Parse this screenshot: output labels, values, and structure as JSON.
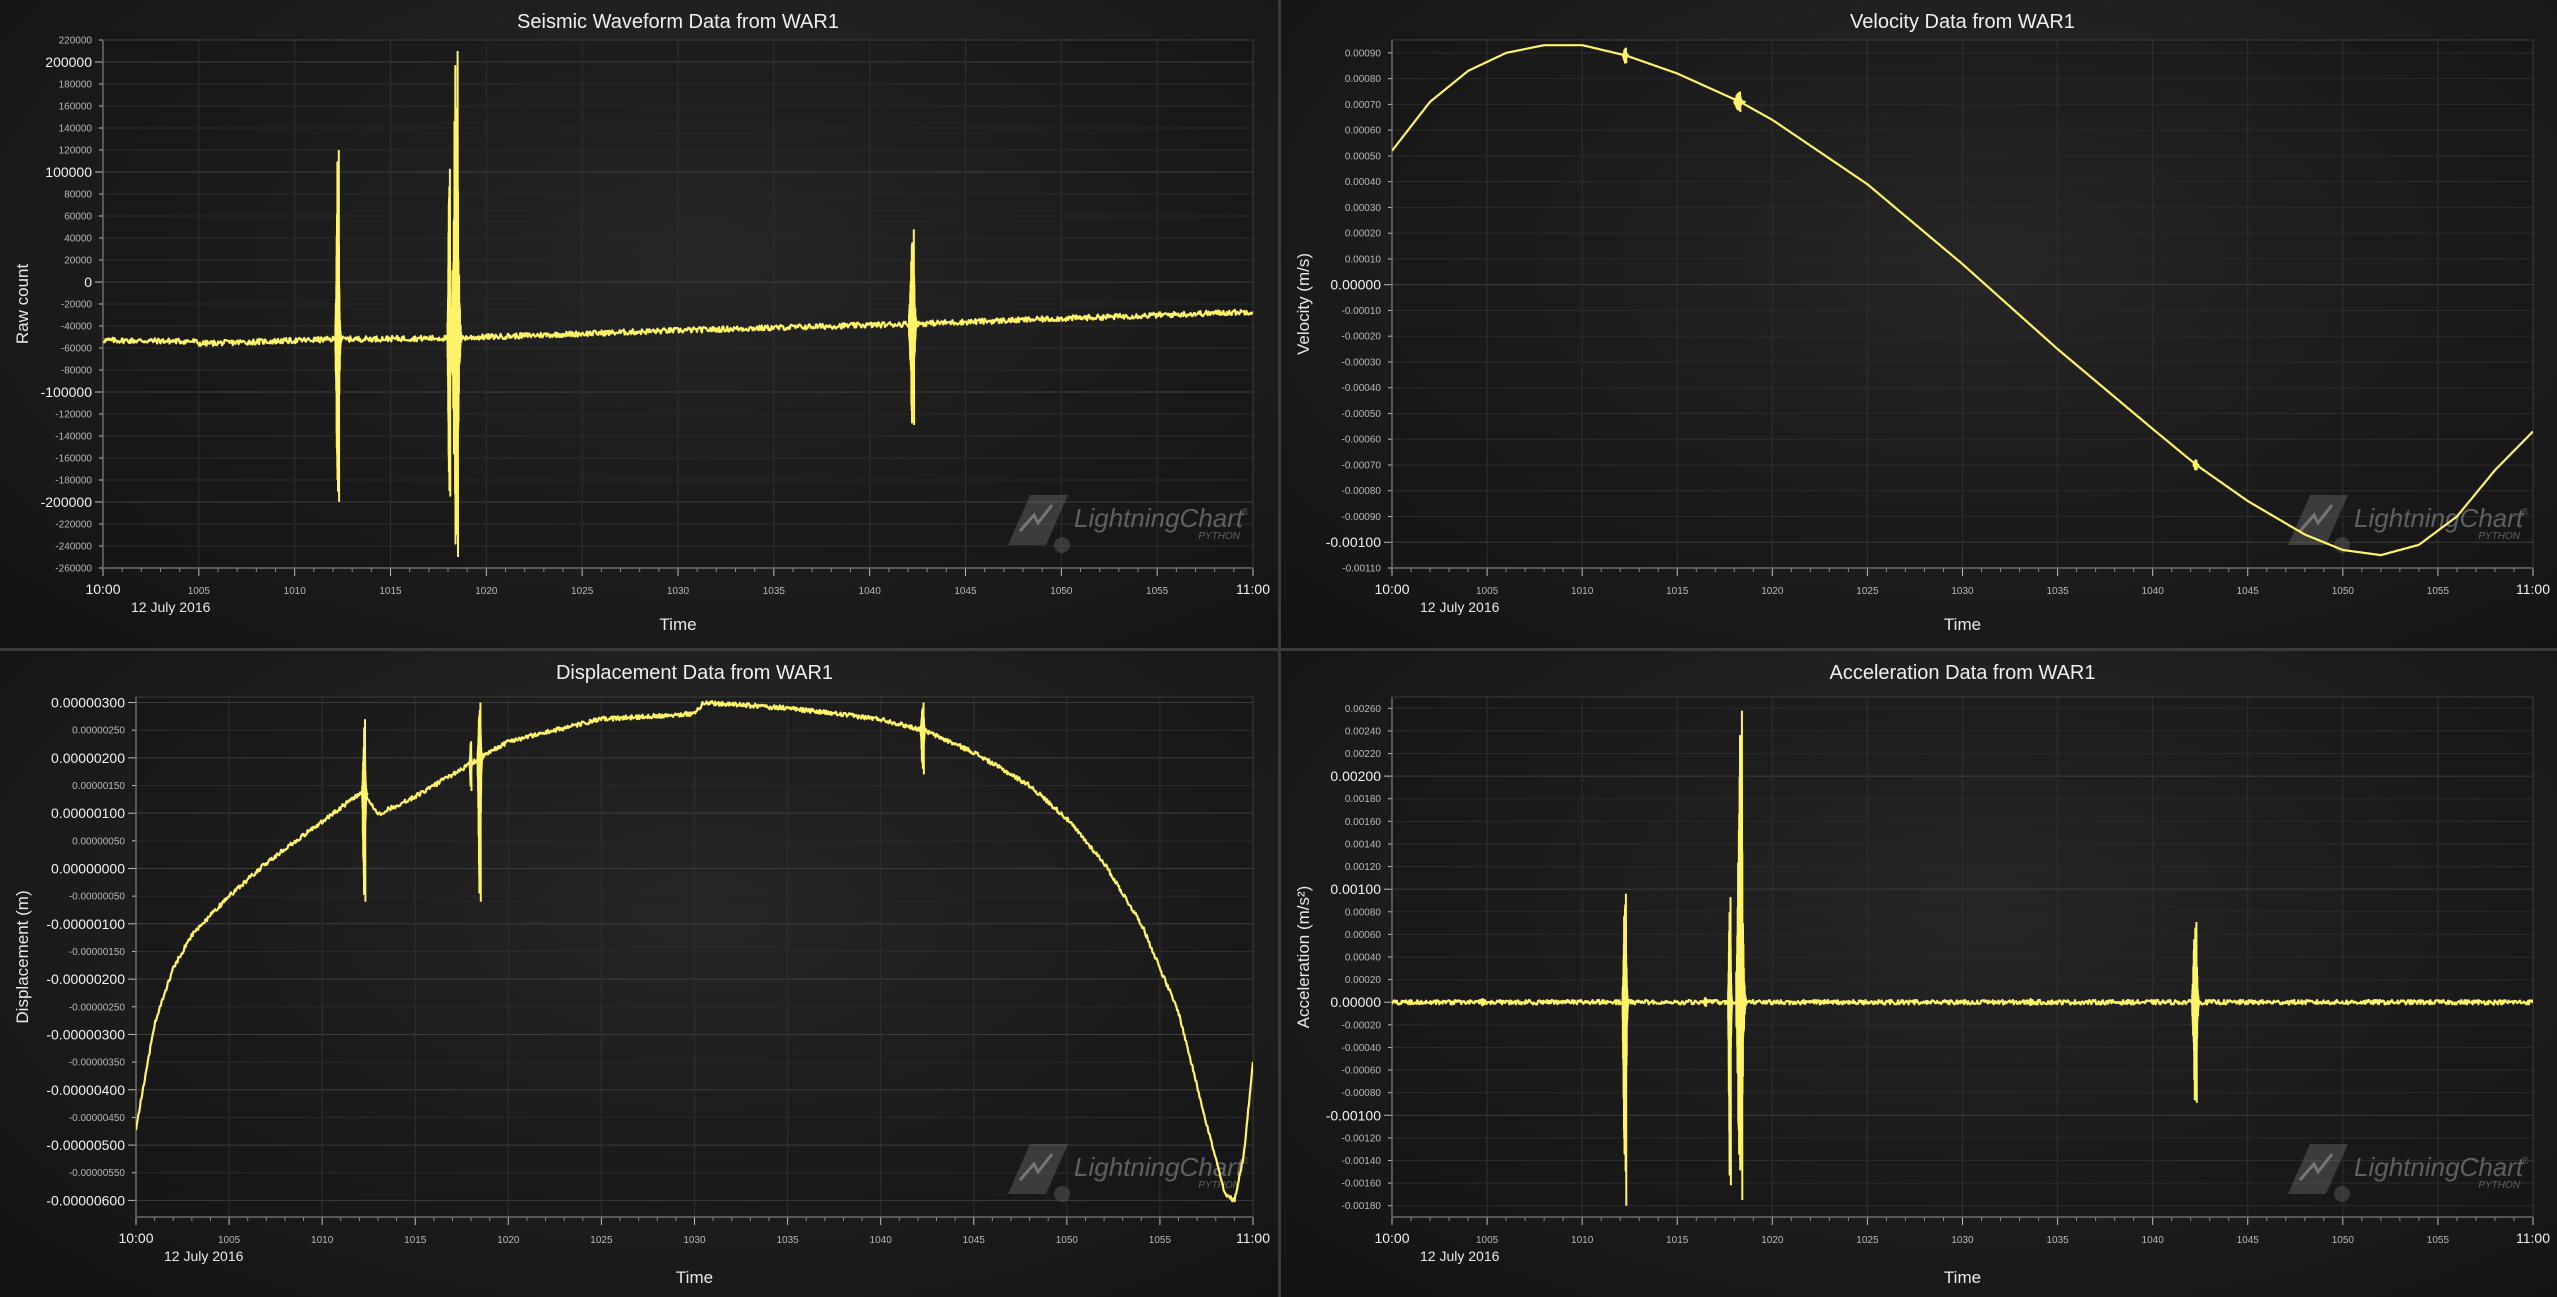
{
  "watermark": {
    "brand": "LightningChart",
    "mark": "®",
    "sub": "PYTHON"
  },
  "chart_data": [
    {
      "type": "line",
      "title": "Seismic Waveform Data from WAR1",
      "xlabel": "Time",
      "ylabel": "Raw count",
      "date_label": "12 July 2016",
      "x_ticks": [
        "10:00",
        "1005",
        "1010",
        "1015",
        "1020",
        "1025",
        "1030",
        "1035",
        "1040",
        "1045",
        "1050",
        "1055",
        "11:00"
      ],
      "x_range_minutes": [
        0,
        60
      ],
      "ylim": [
        -260000,
        220000
      ],
      "y_major_step": 100000,
      "y_minor_step": 20000,
      "y_label_decimals": 0,
      "color": "#fff36a",
      "series": [
        {
          "values": [
            {
              "t": 0,
              "v": -53000
            },
            {
              "t": 4.8,
              "v": -54000
            },
            {
              "t": 5,
              "v": -56000
            },
            {
              "t": 12.2,
              "v": -52000
            },
            {
              "t": 18.2,
              "v": -51000
            },
            {
              "t": 30,
              "v": -44000
            },
            {
              "t": 42.3,
              "v": -38000
            },
            {
              "t": 60,
              "v": -27000
            }
          ]
        }
      ],
      "noise": 2500,
      "events": [
        {
          "t": 12.3,
          "max": 120000,
          "min": -200000,
          "width": 0.35
        },
        {
          "t": 18.1,
          "max": 103000,
          "min": -195000,
          "width": 0.25
        },
        {
          "t": 18.5,
          "max": 210000,
          "min": -250000,
          "width": 0.6
        },
        {
          "t": 42.3,
          "max": 48000,
          "min": -130000,
          "width": 0.5
        }
      ]
    },
    {
      "type": "line",
      "title": "Velocity Data from WAR1",
      "xlabel": "Time",
      "ylabel": "Velocity (m/s)",
      "date_label": "12 July 2016",
      "x_ticks": [
        "10:00",
        "1005",
        "1010",
        "1015",
        "1020",
        "1025",
        "1030",
        "1035",
        "1040",
        "1045",
        "1050",
        "1055",
        "11:00"
      ],
      "x_range_minutes": [
        0,
        60
      ],
      "ylim": [
        -0.0011,
        0.00095
      ],
      "y_major_step": 0.001,
      "y_minor_step": 0.0001,
      "y_label_decimals": 5,
      "color": "#fff36a",
      "series": [
        {
          "values": [
            {
              "t": 0,
              "v": 0.00052
            },
            {
              "t": 2,
              "v": 0.00071
            },
            {
              "t": 4,
              "v": 0.00083
            },
            {
              "t": 6,
              "v": 0.0009
            },
            {
              "t": 8,
              "v": 0.00093
            },
            {
              "t": 10,
              "v": 0.00093
            },
            {
              "t": 12.3,
              "v": 0.00089
            },
            {
              "t": 15,
              "v": 0.00082
            },
            {
              "t": 18.3,
              "v": 0.00071
            },
            {
              "t": 20,
              "v": 0.00064
            },
            {
              "t": 25,
              "v": 0.00039
            },
            {
              "t": 30,
              "v": 8e-05
            },
            {
              "t": 35,
              "v": -0.00025
            },
            {
              "t": 40,
              "v": -0.00056
            },
            {
              "t": 42.3,
              "v": -0.0007
            },
            {
              "t": 45,
              "v": -0.00084
            },
            {
              "t": 48,
              "v": -0.00097
            },
            {
              "t": 50,
              "v": -0.00103
            },
            {
              "t": 52,
              "v": -0.00105
            },
            {
              "t": 54,
              "v": -0.00101
            },
            {
              "t": 56,
              "v": -0.0009
            },
            {
              "t": 58,
              "v": -0.00072
            },
            {
              "t": 60,
              "v": -0.00057
            }
          ]
        }
      ],
      "noise": 0,
      "events": [
        {
          "t": 12.3,
          "max": 0.00092,
          "min": 0.00086,
          "width": 0.3
        },
        {
          "t": 18.3,
          "max": 0.00075,
          "min": 0.00067,
          "width": 0.6
        },
        {
          "t": 42.3,
          "max": -0.00068,
          "min": -0.00072,
          "width": 0.3
        }
      ]
    },
    {
      "type": "line",
      "title": "Displacement Data from WAR1",
      "xlabel": "Time",
      "ylabel": "Displacement (m)",
      "date_label": "12 July 2016",
      "x_ticks": [
        "10:00",
        "1005",
        "1010",
        "1015",
        "1020",
        "1025",
        "1030",
        "1035",
        "1040",
        "1045",
        "1050",
        "1055",
        "11:00"
      ],
      "x_range_minutes": [
        0,
        60
      ],
      "ylim": [
        -6.3e-06,
        3.1e-06
      ],
      "y_major_step": 1e-06,
      "y_minor_step": 5e-07,
      "y_label_decimals": 8,
      "color": "#fff36a",
      "series": [
        {
          "values": [
            {
              "t": 0,
              "v": -4.7e-06
            },
            {
              "t": 1,
              "v": -2.8e-06
            },
            {
              "t": 2,
              "v": -1.8e-06
            },
            {
              "t": 3,
              "v": -1.2e-06
            },
            {
              "t": 5,
              "v": -5e-07
            },
            {
              "t": 7,
              "v": 1e-07
            },
            {
              "t": 9,
              "v": 6e-07
            },
            {
              "t": 11,
              "v": 1.1e-06
            },
            {
              "t": 12.2,
              "v": 1.4e-06
            },
            {
              "t": 13,
              "v": 9.8e-07
            },
            {
              "t": 15,
              "v": 1.3e-06
            },
            {
              "t": 18,
              "v": 1.9e-06
            },
            {
              "t": 20,
              "v": 2.3e-06
            },
            {
              "t": 25,
              "v": 2.7e-06
            },
            {
              "t": 30,
              "v": 2.8e-06
            },
            {
              "t": 30.5,
              "v": 3e-06
            },
            {
              "t": 35,
              "v": 2.9e-06
            },
            {
              "t": 40,
              "v": 2.7e-06
            },
            {
              "t": 42.3,
              "v": 2.5e-06
            },
            {
              "t": 45,
              "v": 2.1e-06
            },
            {
              "t": 48,
              "v": 1.5e-06
            },
            {
              "t": 50,
              "v": 9e-07
            },
            {
              "t": 52,
              "v": 1e-07
            },
            {
              "t": 54,
              "v": -1e-06
            },
            {
              "t": 56,
              "v": -2.6e-06
            },
            {
              "t": 57.5,
              "v": -4.6e-06
            },
            {
              "t": 58.5,
              "v": -5.9e-06
            },
            {
              "t": 59,
              "v": -6e-06
            },
            {
              "t": 59.5,
              "v": -5.2e-06
            },
            {
              "t": 60,
              "v": -3.5e-06
            }
          ]
        }
      ],
      "noise": 4e-08,
      "events": [
        {
          "t": 12.3,
          "max": 2.7e-06,
          "min": -6e-07,
          "width": 0.3
        },
        {
          "t": 18.0,
          "max": 2.3e-06,
          "min": 1.4e-06,
          "width": 0.15
        },
        {
          "t": 18.5,
          "max": 3e-06,
          "min": -6e-07,
          "width": 0.3
        },
        {
          "t": 42.3,
          "max": 3e-06,
          "min": 1.7e-06,
          "width": 0.3
        }
      ]
    },
    {
      "type": "line",
      "title": "Acceleration Data from WAR1",
      "xlabel": "Time",
      "ylabel": "Acceleration (m/s²)",
      "date_label": "12 July 2016",
      "x_ticks": [
        "10:00",
        "1005",
        "1010",
        "1015",
        "1020",
        "1025",
        "1030",
        "1035",
        "1040",
        "1045",
        "1050",
        "1055",
        "11:00"
      ],
      "x_range_minutes": [
        0,
        60
      ],
      "ylim": [
        -0.0019,
        0.0027
      ],
      "y_major_step": 0.001,
      "y_minor_step": 0.0002,
      "y_label_decimals": 5,
      "color": "#fff36a",
      "series": [
        {
          "values": [
            {
              "t": 0,
              "v": 0.0
            },
            {
              "t": 60,
              "v": 0.0
            }
          ]
        }
      ],
      "noise": 2e-05,
      "events": [
        {
          "t": 4.8,
          "max": 3e-05,
          "min": -3e-05,
          "width": 0.3
        },
        {
          "t": 12.3,
          "max": 0.00096,
          "min": -0.0018,
          "width": 0.35
        },
        {
          "t": 16.5,
          "max": 4e-05,
          "min": -4e-05,
          "width": 0.2
        },
        {
          "t": 17.8,
          "max": 0.00093,
          "min": -0.00162,
          "width": 0.25
        },
        {
          "t": 18.4,
          "max": 0.00258,
          "min": -0.00175,
          "width": 0.6
        },
        {
          "t": 33.6,
          "max": 3e-05,
          "min": -3e-05,
          "width": 0.2
        },
        {
          "t": 42.3,
          "max": 0.00071,
          "min": -0.00089,
          "width": 0.45
        },
        {
          "t": 44.6,
          "max": 2e-05,
          "min": -2e-05,
          "width": 0.2
        }
      ]
    }
  ]
}
